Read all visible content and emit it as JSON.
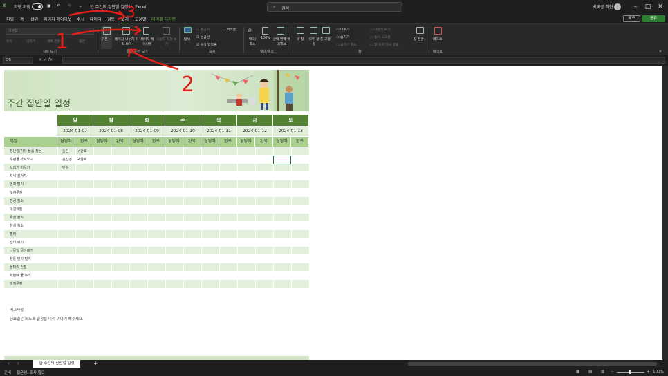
{
  "titlebar": {
    "autosave_label": "자동 저장",
    "doc_title": "한 주간의 집안일 일정1 - Excel",
    "search_placeholder": "검색",
    "user": "박국공 하얀"
  },
  "menu": {
    "tabs": [
      "파일",
      "홈",
      "삽입",
      "페이지 레이아웃",
      "수식",
      "데이터",
      "검토",
      "보기",
      "도움말",
      "테이블 디자인"
    ],
    "active": "보기",
    "memo_label": "메모",
    "share_label": "공유"
  },
  "ribbon": {
    "style_dropdown": "기본값",
    "sheetview_buttons": [
      "유지",
      "나가기",
      "새로 만들기",
      "옵션"
    ],
    "sheetview_label": "시트 보기",
    "workbook_views": [
      "기본",
      "페이지 나누기 미리 보기",
      "페이지 레이아웃",
      "사용자 지정 보기"
    ],
    "workbook_label": "통합 문서 보기",
    "show_items": [
      "눈금자",
      "눈금선",
      "수식 입력줄",
      "머리글"
    ],
    "show_main": "탐색",
    "show_label": "표시",
    "zoom_items": [
      "확대/축소",
      "100%",
      "선택 영역 확대/축소"
    ],
    "zoom_label": "확대/축소",
    "window_items": [
      "새 창",
      "모두 정렬",
      "틀 고정",
      "나누기",
      "숨기기",
      "숨기기 취소",
      "나란히 보기",
      "동시 스크롤",
      "창 위치 다시 정렬",
      "창 전환"
    ],
    "window_label": "창",
    "macro_item": "매크로",
    "macro_label": "매크로"
  },
  "formula_bar": {
    "cell_ref": "O6",
    "fx": "fx",
    "value": ""
  },
  "sheet": {
    "title": "주간 집안일 일정",
    "days": [
      "일",
      "월",
      "화",
      "수",
      "목",
      "금",
      "토"
    ],
    "dates": [
      "2024-01-07",
      "2024-01-08",
      "2024-01-09",
      "2024-01-10",
      "2024-01-11",
      "2024-01-12",
      "2024-01-13"
    ],
    "sub_assignee": "담당자",
    "sub_done": "완료",
    "task_header": "작업",
    "tasks": [
      "장난감/기타 물품 정돈",
      "우편물 가져오기",
      "쓰레기 비우기",
      "저녁 설거지",
      "먼지 털기",
      "빗자루질",
      "진공 청소",
      "대걸레질",
      "욕실 청소",
      "침실 청소",
      "빨래",
      "잔디 깎기",
      "나뭇잎 긁어내기",
      "창틀 먼지 털기",
      "울타리 손질",
      "화분에 물 주기",
      "빗자루질"
    ],
    "entries": [
      {
        "assignee": "종민",
        "done": "✔완료"
      },
      {
        "assignee": "김진영",
        "done": "✔완료"
      },
      {
        "assignee": "민수",
        "done": ""
      }
    ],
    "notes_label": "비고사항",
    "notes_text": "금요일은 외도록 일정을 미리 이야기 해주세요."
  },
  "sheet_tabs": {
    "active": "한 주간의 집안일 일정",
    "add": "+"
  },
  "status": {
    "ready": "준비",
    "accessibility": "접근성: 조사 필요",
    "zoom": "100%"
  },
  "annotations": [
    "1",
    "2",
    "3"
  ]
}
